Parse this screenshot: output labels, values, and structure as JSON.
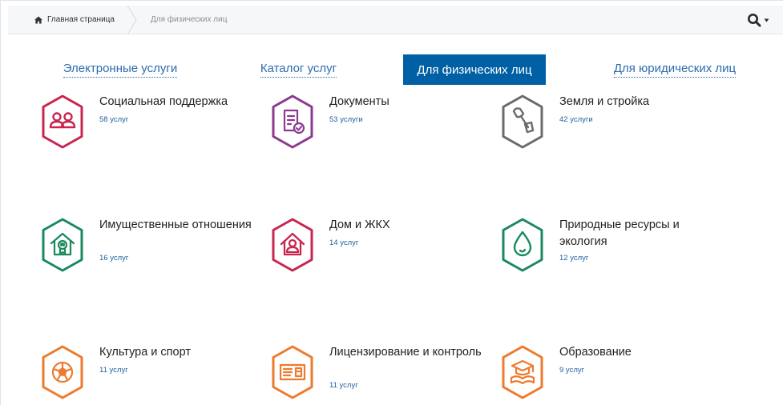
{
  "header": {
    "home_label": "Главная страница",
    "current_label": "Для физических лиц"
  },
  "tabs": [
    {
      "label": "Электронные услуги",
      "active": false
    },
    {
      "label": "Каталог услуг",
      "active": false
    },
    {
      "label": "Для физических лиц",
      "active": true
    },
    {
      "label": "Для юридических лиц",
      "active": false
    }
  ],
  "colors": {
    "crimson": "#c8264f",
    "purple": "#8b3a8f",
    "gray": "#6b6b6b",
    "green": "#1a8a5e",
    "orange": "#ee7a2e",
    "link": "#1f5fa0",
    "tab_active": "#0060a6"
  },
  "categories": [
    {
      "title": "Социальная поддержка",
      "count": "58 услуг",
      "icon": "people-icon",
      "color": "crimson"
    },
    {
      "title": "Документы",
      "count": "53 услуги",
      "icon": "document-icon",
      "color": "purple"
    },
    {
      "title": "Земля и стройка",
      "count": "42 услуги",
      "icon": "trowel-icon",
      "color": "gray"
    },
    {
      "title": "Имущественные отношения",
      "count": "16 услуг",
      "icon": "house-certificate-icon",
      "color": "green"
    },
    {
      "title": "Дом и ЖКХ",
      "count": "14 услуг",
      "icon": "house-user-icon",
      "color": "crimson"
    },
    {
      "title": "Природные ресурсы и экология",
      "count": "12 услуг",
      "icon": "water-drop-icon",
      "color": "green"
    },
    {
      "title": "Культура и спорт",
      "count": "11 услуг",
      "icon": "soccer-ball-icon",
      "color": "orange"
    },
    {
      "title": "Лицензирование и контроль",
      "count": "11 услуг",
      "icon": "license-icon",
      "color": "orange"
    },
    {
      "title": "Образование",
      "count": "9 услуг",
      "icon": "graduation-cap-icon",
      "color": "orange"
    }
  ]
}
